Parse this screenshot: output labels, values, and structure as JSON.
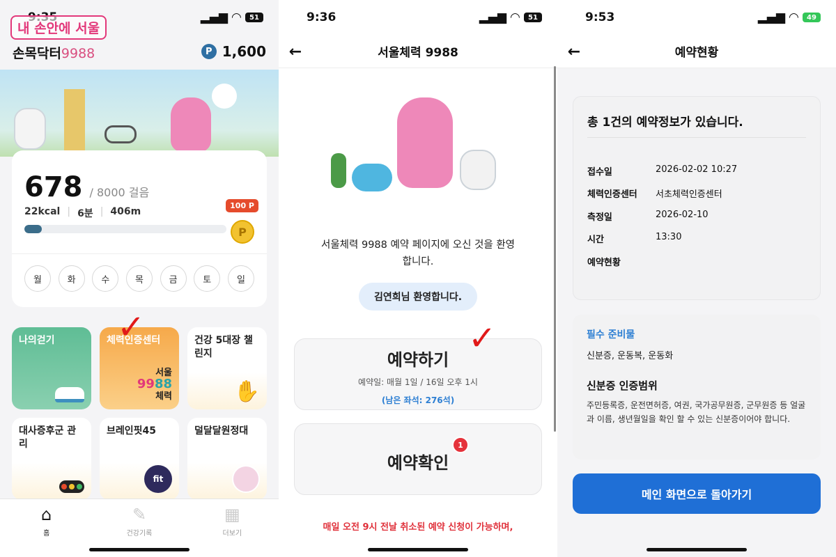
{
  "panel1": {
    "status_time": "9:35",
    "battery": "51",
    "logo_badge": "내 손안에 서울",
    "app_title": "손목닥터",
    "app_title_num": "9988",
    "point_icon": "P",
    "points": "1,600",
    "steps": "678",
    "steps_goal": "/ 8000 걸음",
    "kcal": "22kcal",
    "minutes": "6분",
    "distance": "406m",
    "reward_badge": "100 P",
    "coin_label": "P",
    "progress": 0.085,
    "days": [
      "월",
      "화",
      "수",
      "목",
      "금",
      "토",
      "일"
    ],
    "tiles": [
      {
        "label": "나의걷기"
      },
      {
        "label": "체력인증센터"
      },
      {
        "label": "건강 5대장 챌린지"
      },
      {
        "label": "대사증후군 관리"
      },
      {
        "label": "브레인핏45"
      },
      {
        "label": "덜달달원정대"
      }
    ],
    "seoul_logo": {
      "top": "서울",
      "num1": "99",
      "num2": "88",
      "bottom": "체력"
    },
    "brain_logo": "fit",
    "tabs": [
      {
        "label": "홈",
        "icon": "home-icon"
      },
      {
        "label": "건강기록",
        "icon": "pencil-icon"
      },
      {
        "label": "더보기",
        "icon": "grid-icon"
      }
    ]
  },
  "panel2": {
    "status_time": "9:36",
    "battery": "51",
    "title": "서울체력 9988",
    "welcome_line1": "서울체력 9988 예약 페이지에 오신 것을 환영",
    "welcome_line2": "합니다.",
    "name_chip": "김연희님 환영합니다.",
    "reserve_title": "예약하기",
    "reserve_date": "예약일: 매월 1일 / 16일 오후 1시",
    "remaining": "(남은 좌석: 276석)",
    "confirm_title": "예약확인",
    "confirm_badge": "1",
    "notice": "매일 오전 9시 전날 취소된 예약 신청이 가능하며,"
  },
  "panel3": {
    "status_time": "9:53",
    "battery": "49",
    "title": "예약현황",
    "summary": "총 1건의 예약정보가 있습니다.",
    "rows": [
      {
        "label": "접수일",
        "value": "2026-02-02 10:27"
      },
      {
        "label": "체력인증센터",
        "value": "서초체력인증센터"
      },
      {
        "label": "측정일",
        "value": "2026-02-10"
      },
      {
        "label": "시간",
        "value": "13:30"
      },
      {
        "label": "예약현황",
        "value": ""
      }
    ],
    "prep_title": "필수 준비물",
    "prep_items": "신분증, 운동복, 운동화",
    "id_title": "신분증 인증범위",
    "id_desc": "주민등록증, 운전면허증, 여권, 국가공무원증, 군무원증 등 얼굴과 이름, 생년월일을 확인 할 수 있는 신분증이어야 합니다.",
    "main_button": "메인 화면으로 돌아가기"
  },
  "colors": {
    "accent_blue": "#1f6fd6",
    "pink_brand": "#e2387a",
    "notice_red": "#e0313b",
    "annotation_check": "#e11919"
  }
}
